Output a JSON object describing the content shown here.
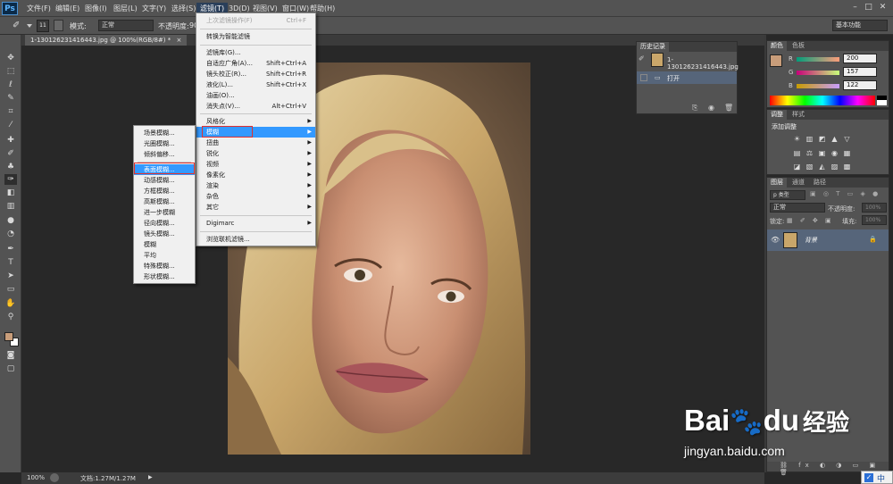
{
  "menubar": {
    "logo": "Ps",
    "items": [
      "文件(F)",
      "编辑(E)",
      "图像(I)",
      "图层(L)",
      "文字(Y)",
      "选择(S)",
      "滤镜(T)",
      "3D(D)",
      "视图(V)",
      "窗口(W)",
      "帮助(H)"
    ],
    "active_index": 6,
    "window_controls": [
      "–",
      "□",
      "✕"
    ]
  },
  "options_bar": {
    "brush_size": "11",
    "mode_label": "模式:",
    "mode_value": "正常",
    "opacity_label": "不透明度:",
    "opacity_value": "90",
    "workspace": "基本功能"
  },
  "document": {
    "tab_title": "1-130126231416443.jpg @ 100%(RGB/8#) *",
    "tab_close": "×"
  },
  "status_bar": {
    "zoom": "100%",
    "doc_info": "文档:1.27M/1.27M"
  },
  "filter_menu": {
    "items": [
      {
        "label": "上次滤镜操作(F)",
        "shortcut": "Ctrl+F",
        "disabled": true
      },
      {
        "label": "转换为智能滤镜"
      },
      {
        "label": "滤镜库(G)..."
      },
      {
        "label": "自适应广角(A)...",
        "shortcut": "Shift+Ctrl+A"
      },
      {
        "label": "镜头校正(R)...",
        "shortcut": "Shift+Ctrl+R"
      },
      {
        "label": "液化(L)...",
        "shortcut": "Shift+Ctrl+X"
      },
      {
        "label": "油画(O)..."
      },
      {
        "label": "消失点(V)...",
        "shortcut": "Alt+Ctrl+V"
      },
      {
        "label": "风格化",
        "submenu": true
      },
      {
        "label": "模糊",
        "submenu": true,
        "highlight": true
      },
      {
        "label": "扭曲",
        "submenu": true
      },
      {
        "label": "锐化",
        "submenu": true
      },
      {
        "label": "视频",
        "submenu": true
      },
      {
        "label": "像素化",
        "submenu": true
      },
      {
        "label": "渲染",
        "submenu": true
      },
      {
        "label": "杂色",
        "submenu": true
      },
      {
        "label": "其它",
        "submenu": true
      },
      {
        "label": "Digimarc",
        "submenu": true
      },
      {
        "label": "浏览联机滤镜..."
      }
    ]
  },
  "blur_submenu": {
    "items": [
      "场景模糊...",
      "光圈模糊...",
      "倾斜偏移...",
      "表面模糊...",
      "动感模糊...",
      "方框模糊...",
      "高斯模糊...",
      "进一步模糊",
      "径向模糊...",
      "镜头模糊...",
      "模糊",
      "平均",
      "特殊模糊...",
      "形状模糊..."
    ],
    "highlight_index": 3
  },
  "history_panel": {
    "title": "历史记录",
    "snapshot_name": "1-130126231416443.jpg",
    "steps": [
      "打开"
    ]
  },
  "color_panel": {
    "tabs": [
      "颜色",
      "色板"
    ],
    "channels": [
      {
        "label": "R",
        "value": "200"
      },
      {
        "label": "G",
        "value": "157"
      },
      {
        "label": "B",
        "value": "122"
      }
    ],
    "foreground": "#c89d7a"
  },
  "adjust_panel": {
    "tabs": [
      "调整",
      "样式"
    ],
    "title": "添加调整",
    "row1": [
      "☀",
      "▥",
      "◩",
      "▲",
      "▽"
    ],
    "row2": [
      "▤",
      "⚖",
      "▣",
      "◉",
      "▦"
    ],
    "row3": [
      "◪",
      "▧",
      "◭",
      "▨",
      "▩"
    ]
  },
  "layers_panel": {
    "tabs": [
      "图层",
      "通道",
      "路径"
    ],
    "filter_label": "p 类型",
    "blend_mode": "正常",
    "opacity_label": "不透明度:",
    "opacity_value": "100%",
    "lock_label": "锁定:",
    "fill_label": "填充:",
    "fill_value": "100%",
    "layer_name": "背景"
  },
  "watermark": {
    "brand_a": "Bai",
    "brand_b": "du",
    "brand_cn": "经验",
    "url": "jingyan.baidu.com"
  },
  "taskbar": {
    "ime": "中"
  }
}
